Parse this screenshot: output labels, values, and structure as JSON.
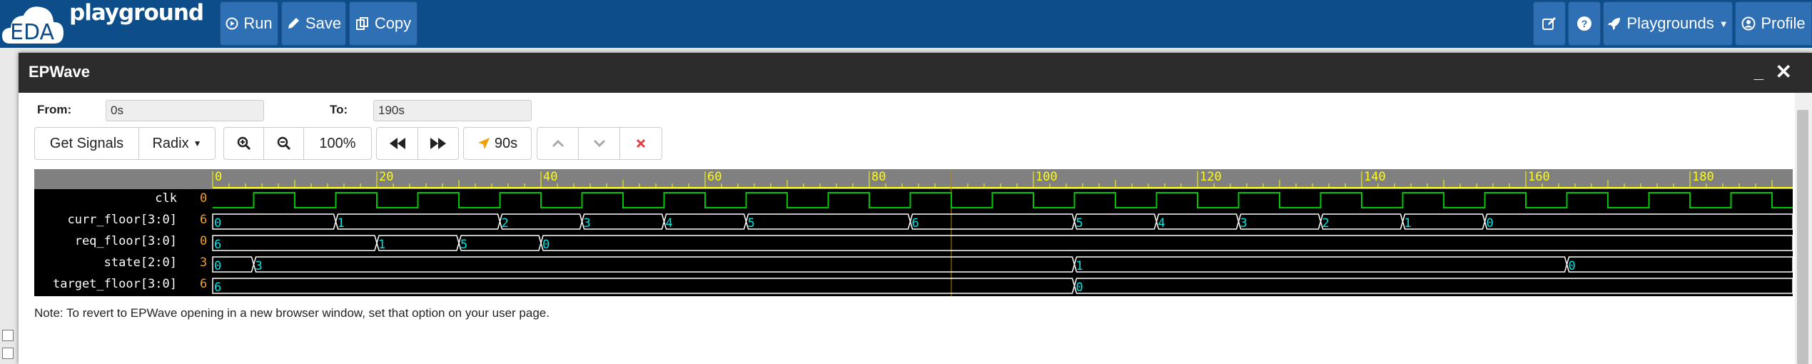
{
  "app": {
    "brand": "playground",
    "logo_text": "EDA"
  },
  "toolbar": {
    "run_label": "Run",
    "save_label": "Save",
    "copy_label": "Copy",
    "playgrounds_label": "Playgrounds",
    "profile_label": "Profile"
  },
  "modal": {
    "title": "EPWave",
    "minimize": "_",
    "close": "✕"
  },
  "range": {
    "from_label": "From:",
    "from_value": "0s",
    "to_label": "To:",
    "to_value": "190s"
  },
  "controls": {
    "get_signals": "Get Signals",
    "radix": "Radix",
    "zoom_level": "100%",
    "marker_time": "90s"
  },
  "signals": [
    {
      "name": "clk",
      "value": "0"
    },
    {
      "name": "curr_floor[3:0]",
      "value": "6"
    },
    {
      "name": "req_floor[3:0]",
      "value": "0"
    },
    {
      "name": "state[2:0]",
      "value": "3"
    },
    {
      "name": "target_floor[3:0]",
      "value": "6"
    }
  ],
  "timeline": {
    "tick_labels": [
      "0",
      "20",
      "40",
      "60",
      "80",
      "100",
      "120",
      "140",
      "160",
      "180"
    ],
    "start": 0,
    "end": 190,
    "cursor_time": 90,
    "clk_period": 10
  },
  "waves": {
    "curr_floor": [
      {
        "t": 0,
        "v": "0"
      },
      {
        "t": 15,
        "v": "1"
      },
      {
        "t": 35,
        "v": "2"
      },
      {
        "t": 45,
        "v": "3"
      },
      {
        "t": 55,
        "v": "4"
      },
      {
        "t": 65,
        "v": "5"
      },
      {
        "t": 85,
        "v": "6"
      },
      {
        "t": 105,
        "v": "5"
      },
      {
        "t": 115,
        "v": "4"
      },
      {
        "t": 125,
        "v": "3"
      },
      {
        "t": 135,
        "v": "2"
      },
      {
        "t": 145,
        "v": "1"
      },
      {
        "t": 155,
        "v": "0"
      }
    ],
    "req_floor": [
      {
        "t": 0,
        "v": "6"
      },
      {
        "t": 20,
        "v": "1"
      },
      {
        "t": 30,
        "v": "5"
      },
      {
        "t": 40,
        "v": "0"
      }
    ],
    "state": [
      {
        "t": 0,
        "v": "0"
      },
      {
        "t": 5,
        "v": "3"
      },
      {
        "t": 105,
        "v": "1"
      },
      {
        "t": 165,
        "v": "0"
      }
    ],
    "target_floor": [
      {
        "t": 0,
        "v": "6"
      },
      {
        "t": 105,
        "v": "0"
      }
    ]
  },
  "note": "Note: To revert to EPWave opening in a new browser window, set that option on your user page.",
  "colors": {
    "topbar": "#0c4d8a",
    "button": "#2f6fb3",
    "clk_wave": "#00c800",
    "bus_wave": "#ffffff",
    "bus_value": "#00e5e5",
    "ruler_tick": "#ffff00",
    "cursor": "#b8860b"
  }
}
